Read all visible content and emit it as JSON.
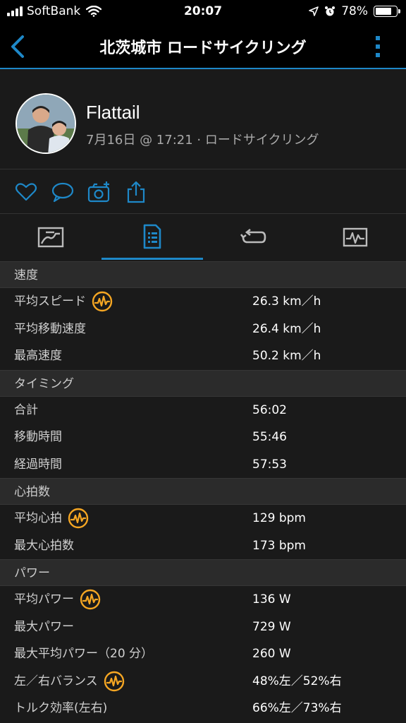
{
  "status": {
    "carrier": "SoftBank",
    "time": "20:07",
    "battery": "78%",
    "battery_level": 0.78
  },
  "nav": {
    "title": "北茨城市 ロードサイクリング"
  },
  "profile": {
    "name": "Flattail",
    "meta": "7月16日 @ 17:21 · ロードサイクリング"
  },
  "sections": {
    "speed": {
      "header": "速度",
      "rows": [
        {
          "label": "平均スピード",
          "value": "26.3 km／h"
        },
        {
          "label": "平均移動速度",
          "value": "26.4 km／h"
        },
        {
          "label": "最高速度",
          "value": "50.2 km／h"
        }
      ]
    },
    "timing": {
      "header": "タイミング",
      "rows": [
        {
          "label": "合計",
          "value": "56:02"
        },
        {
          "label": "移動時間",
          "value": "55:46"
        },
        {
          "label": "経過時間",
          "value": "57:53"
        }
      ]
    },
    "heart": {
      "header": "心拍数",
      "rows": [
        {
          "label": "平均心拍",
          "value": "129 bpm"
        },
        {
          "label": "最大心拍数",
          "value": "173 bpm"
        }
      ]
    },
    "power": {
      "header": "パワー",
      "rows": [
        {
          "label": "平均パワー",
          "value": "136 W"
        },
        {
          "label": "最大パワー",
          "value": "729 W"
        },
        {
          "label": "最大平均パワー（20 分）",
          "value": "260 W"
        },
        {
          "label": "左／右バランス",
          "value": "48%左／52%右"
        },
        {
          "label": "トルク効率(左右)",
          "value": "66%左／73%右"
        }
      ]
    }
  },
  "icons": {
    "back": "chevron-left-icon",
    "menu": "more-vertical-icon",
    "like": "heart-icon",
    "comment": "comment-icon",
    "photo": "camera-add-icon",
    "share": "share-icon",
    "tab1": "map-icon",
    "tab2": "details-icon",
    "tab3": "laps-icon",
    "tab4": "chart-icon",
    "metric": "heart-rate-chart-icon"
  },
  "colors": {
    "accent": "#1e88c8",
    "badge": "#f5a623"
  }
}
